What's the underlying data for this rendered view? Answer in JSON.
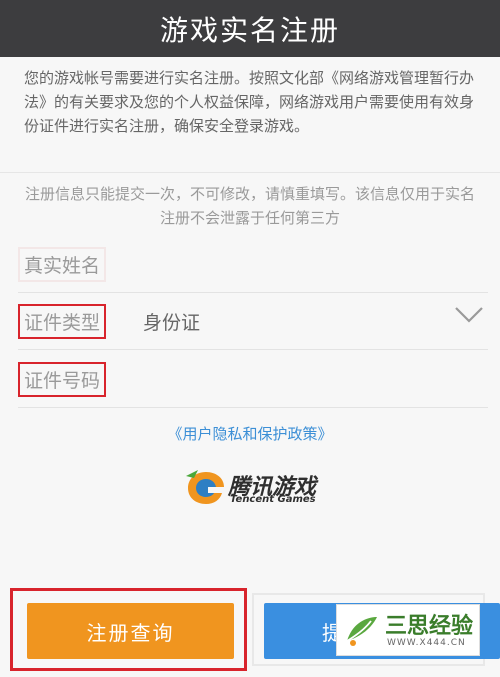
{
  "header": {
    "title": "游戏实名注册"
  },
  "intro": {
    "text": "您的游戏帐号需要进行实名注册。按照文化部《网络游戏管理暂行办法》的有关要求及您的个人权益保障，网络游戏用户需要使用有效身份证件进行实名注册，确保安全登录游戏。"
  },
  "notice": {
    "text": "注册信息只能提交一次，不可修改，请慎重填写。该信息仅用于实名注册不会泄露于任何第三方"
  },
  "form": {
    "name_label": "真实姓名",
    "name_value": "",
    "id_type_label": "证件类型",
    "id_type_value": "身份证",
    "id_number_label": "证件号码",
    "id_number_value": ""
  },
  "policy_link": "《用户隐私和保护政策》",
  "logo": {
    "cn": "腾讯游戏",
    "en": "Tencent Games"
  },
  "buttons": {
    "query": "注册查询",
    "submit_visible": "提"
  },
  "watermark": {
    "text": "三思经验",
    "url": "WWW.X444.CN"
  },
  "colors": {
    "header_bg": "#3d3d3f",
    "query_button": "#f0951f",
    "submit_button": "#3a8fe0",
    "link": "#3c8fd6",
    "highlight_box": "#d8242c"
  }
}
